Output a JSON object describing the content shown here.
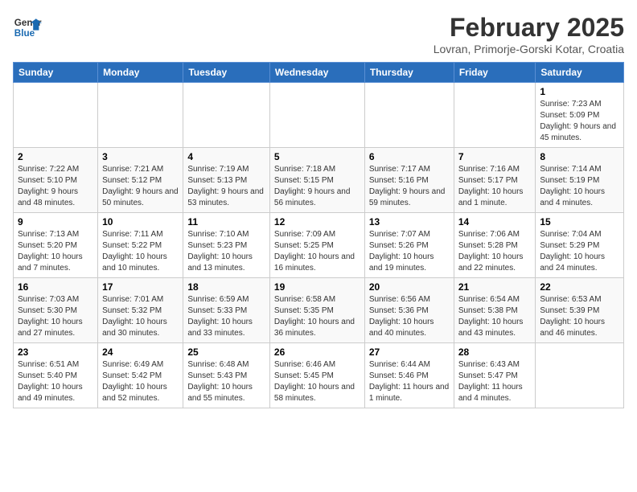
{
  "logo": {
    "line1": "General",
    "line2": "Blue"
  },
  "title": "February 2025",
  "subtitle": "Lovran, Primorje-Gorski Kotar, Croatia",
  "days_of_week": [
    "Sunday",
    "Monday",
    "Tuesday",
    "Wednesday",
    "Thursday",
    "Friday",
    "Saturday"
  ],
  "weeks": [
    [
      {
        "num": "",
        "info": ""
      },
      {
        "num": "",
        "info": ""
      },
      {
        "num": "",
        "info": ""
      },
      {
        "num": "",
        "info": ""
      },
      {
        "num": "",
        "info": ""
      },
      {
        "num": "",
        "info": ""
      },
      {
        "num": "1",
        "info": "Sunrise: 7:23 AM\nSunset: 5:09 PM\nDaylight: 9 hours and 45 minutes."
      }
    ],
    [
      {
        "num": "2",
        "info": "Sunrise: 7:22 AM\nSunset: 5:10 PM\nDaylight: 9 hours and 48 minutes."
      },
      {
        "num": "3",
        "info": "Sunrise: 7:21 AM\nSunset: 5:12 PM\nDaylight: 9 hours and 50 minutes."
      },
      {
        "num": "4",
        "info": "Sunrise: 7:19 AM\nSunset: 5:13 PM\nDaylight: 9 hours and 53 minutes."
      },
      {
        "num": "5",
        "info": "Sunrise: 7:18 AM\nSunset: 5:15 PM\nDaylight: 9 hours and 56 minutes."
      },
      {
        "num": "6",
        "info": "Sunrise: 7:17 AM\nSunset: 5:16 PM\nDaylight: 9 hours and 59 minutes."
      },
      {
        "num": "7",
        "info": "Sunrise: 7:16 AM\nSunset: 5:17 PM\nDaylight: 10 hours and 1 minute."
      },
      {
        "num": "8",
        "info": "Sunrise: 7:14 AM\nSunset: 5:19 PM\nDaylight: 10 hours and 4 minutes."
      }
    ],
    [
      {
        "num": "9",
        "info": "Sunrise: 7:13 AM\nSunset: 5:20 PM\nDaylight: 10 hours and 7 minutes."
      },
      {
        "num": "10",
        "info": "Sunrise: 7:11 AM\nSunset: 5:22 PM\nDaylight: 10 hours and 10 minutes."
      },
      {
        "num": "11",
        "info": "Sunrise: 7:10 AM\nSunset: 5:23 PM\nDaylight: 10 hours and 13 minutes."
      },
      {
        "num": "12",
        "info": "Sunrise: 7:09 AM\nSunset: 5:25 PM\nDaylight: 10 hours and 16 minutes."
      },
      {
        "num": "13",
        "info": "Sunrise: 7:07 AM\nSunset: 5:26 PM\nDaylight: 10 hours and 19 minutes."
      },
      {
        "num": "14",
        "info": "Sunrise: 7:06 AM\nSunset: 5:28 PM\nDaylight: 10 hours and 22 minutes."
      },
      {
        "num": "15",
        "info": "Sunrise: 7:04 AM\nSunset: 5:29 PM\nDaylight: 10 hours and 24 minutes."
      }
    ],
    [
      {
        "num": "16",
        "info": "Sunrise: 7:03 AM\nSunset: 5:30 PM\nDaylight: 10 hours and 27 minutes."
      },
      {
        "num": "17",
        "info": "Sunrise: 7:01 AM\nSunset: 5:32 PM\nDaylight: 10 hours and 30 minutes."
      },
      {
        "num": "18",
        "info": "Sunrise: 6:59 AM\nSunset: 5:33 PM\nDaylight: 10 hours and 33 minutes."
      },
      {
        "num": "19",
        "info": "Sunrise: 6:58 AM\nSunset: 5:35 PM\nDaylight: 10 hours and 36 minutes."
      },
      {
        "num": "20",
        "info": "Sunrise: 6:56 AM\nSunset: 5:36 PM\nDaylight: 10 hours and 40 minutes."
      },
      {
        "num": "21",
        "info": "Sunrise: 6:54 AM\nSunset: 5:38 PM\nDaylight: 10 hours and 43 minutes."
      },
      {
        "num": "22",
        "info": "Sunrise: 6:53 AM\nSunset: 5:39 PM\nDaylight: 10 hours and 46 minutes."
      }
    ],
    [
      {
        "num": "23",
        "info": "Sunrise: 6:51 AM\nSunset: 5:40 PM\nDaylight: 10 hours and 49 minutes."
      },
      {
        "num": "24",
        "info": "Sunrise: 6:49 AM\nSunset: 5:42 PM\nDaylight: 10 hours and 52 minutes."
      },
      {
        "num": "25",
        "info": "Sunrise: 6:48 AM\nSunset: 5:43 PM\nDaylight: 10 hours and 55 minutes."
      },
      {
        "num": "26",
        "info": "Sunrise: 6:46 AM\nSunset: 5:45 PM\nDaylight: 10 hours and 58 minutes."
      },
      {
        "num": "27",
        "info": "Sunrise: 6:44 AM\nSunset: 5:46 PM\nDaylight: 11 hours and 1 minute."
      },
      {
        "num": "28",
        "info": "Sunrise: 6:43 AM\nSunset: 5:47 PM\nDaylight: 11 hours and 4 minutes."
      },
      {
        "num": "",
        "info": ""
      }
    ]
  ]
}
